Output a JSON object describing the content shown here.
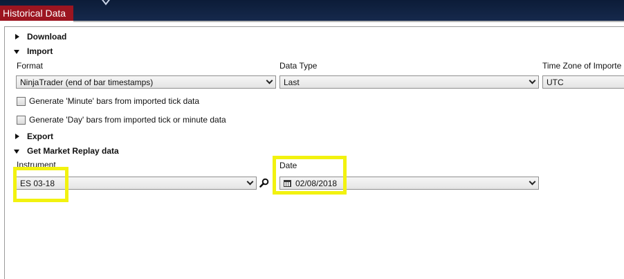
{
  "window": {
    "title": "Historical Data"
  },
  "sections": {
    "download": {
      "label": "Download"
    },
    "import": {
      "label": "Import"
    },
    "export": {
      "label": "Export"
    },
    "replay": {
      "label": "Get Market Replay data"
    }
  },
  "import": {
    "format_label": "Format",
    "format_value": "NinjaTrader (end of bar timestamps)",
    "datatype_label": "Data Type",
    "datatype_value": "Last",
    "timezone_label": "Time Zone of Importe",
    "timezone_value": "UTC",
    "minute_bars_label": "Generate 'Minute' bars from imported tick data",
    "day_bars_label": "Generate 'Day' bars from imported tick or minute data"
  },
  "replay": {
    "instrument_label": "Instrument",
    "instrument_value": "ES 03-18",
    "date_label": "Date",
    "date_value": "02/08/2018"
  },
  "icons": {
    "search": "magnifier-icon",
    "calendar": "calendar-icon",
    "collapse": "triangle-down-icon",
    "expand": "triangle-right-icon",
    "dropdown": "chevron-down-icon"
  },
  "colors": {
    "title_tab": "#9c1520",
    "topbar": "#0c1c38",
    "highlight": "#f2f20f"
  }
}
